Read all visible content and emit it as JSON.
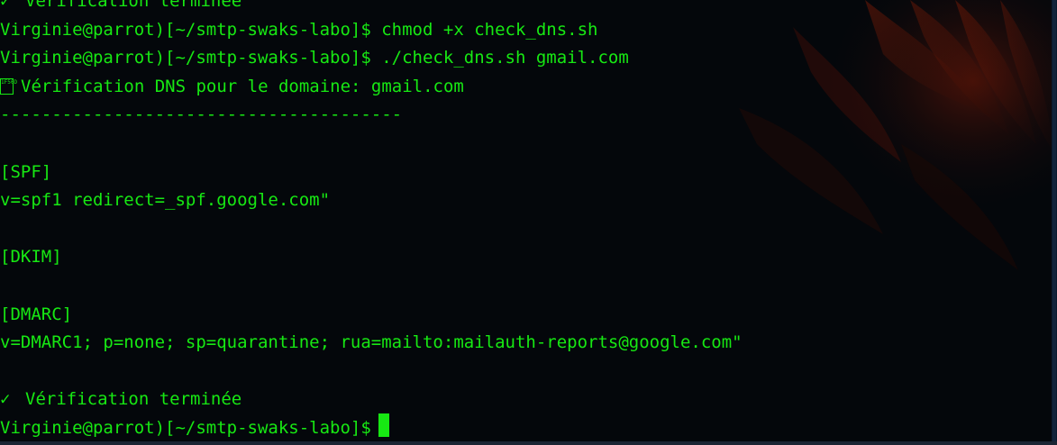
{
  "terminal": {
    "lines": [
      {
        "type": "check",
        "text": "Vérification terminée"
      },
      {
        "type": "text",
        "text": "Virginie@parrot)[~/smtp-swaks-labo]$ chmod +x check_dns.sh"
      },
      {
        "type": "text",
        "text": "Virginie@parrot)[~/smtp-swaks-labo]$ ./check_dns.sh gmail.com"
      },
      {
        "type": "box",
        "text": "Vérification DNS pour le domaine: gmail.com",
        "glyph": "1F50D"
      },
      {
        "type": "text",
        "text": "---------------------------------------"
      },
      {
        "type": "text",
        "text": ""
      },
      {
        "type": "text",
        "text": "[SPF]"
      },
      {
        "type": "text",
        "text": "v=spf1 redirect=_spf.google.com\""
      },
      {
        "type": "text",
        "text": ""
      },
      {
        "type": "text",
        "text": "[DKIM]"
      },
      {
        "type": "text",
        "text": ""
      },
      {
        "type": "text",
        "text": "[DMARC]"
      },
      {
        "type": "text",
        "text": "v=DMARC1; p=none; sp=quarantine; rua=mailto:mailauth-reports@google.com\""
      },
      {
        "type": "text",
        "text": ""
      },
      {
        "type": "check",
        "text": "Vérification terminée"
      },
      {
        "type": "prompt",
        "text": "Virginie@parrot)[~/smtp-swaks-labo]$"
      }
    ]
  },
  "colors": {
    "background": "#04070b",
    "terminal_text": "#17e813",
    "wallpaper_accent": "#7a1a08"
  },
  "icons": {
    "check": "check-mark-icon",
    "box": "missing-glyph-icon"
  }
}
